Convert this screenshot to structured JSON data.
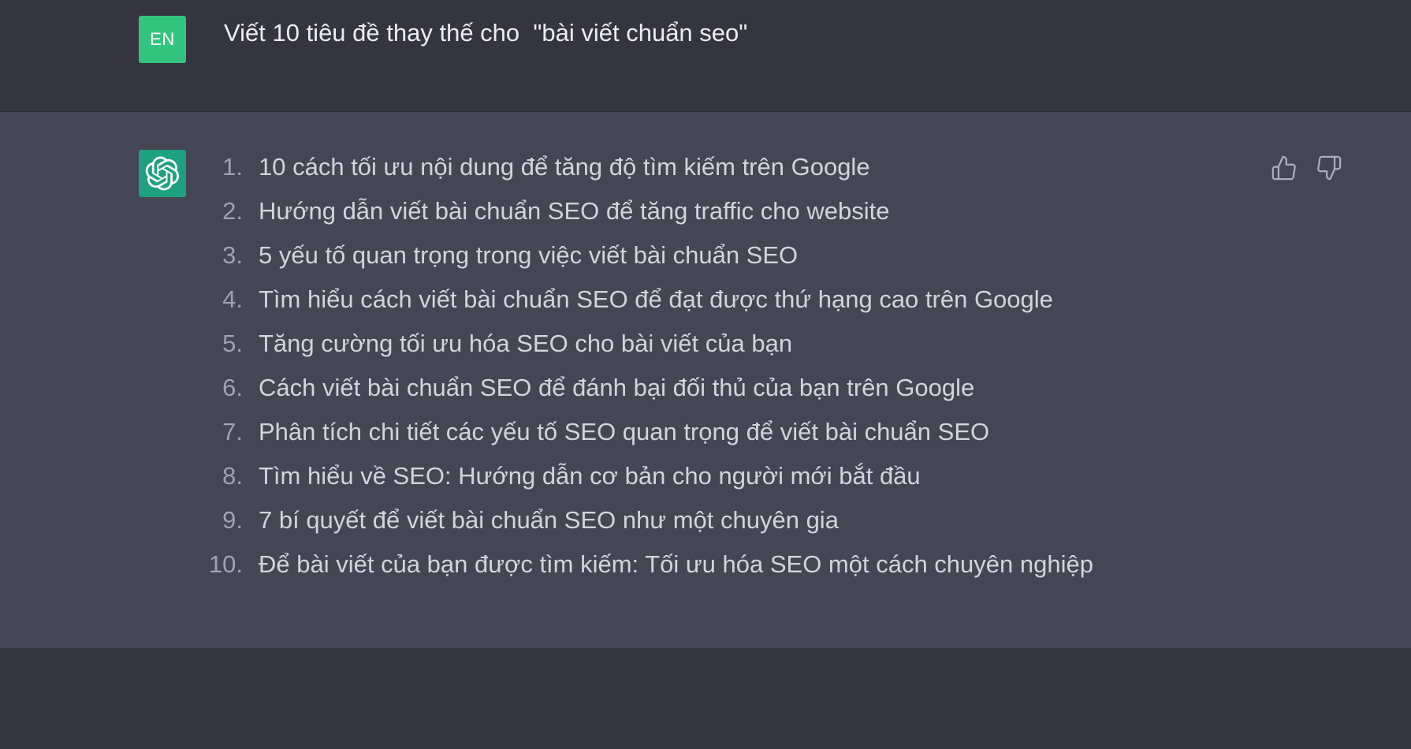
{
  "colors": {
    "user_avatar_bg": "#33c57d",
    "bot_avatar_bg": "#1ea180",
    "page_bg": "#343541",
    "answer_bg": "#444654"
  },
  "user_message": {
    "avatar_text": "EN",
    "text": "Viết 10 tiêu đề thay thế cho  \"bài viết chuẩn seo\""
  },
  "assistant_message": {
    "avatar_icon": "openai-logo-icon",
    "items": [
      {
        "num": "1.",
        "text": "10 cách tối ưu nội dung để tăng độ tìm kiếm trên Google"
      },
      {
        "num": "2.",
        "text": "Hướng dẫn viết bài chuẩn SEO để tăng traffic cho website"
      },
      {
        "num": "3.",
        "text": "5 yếu tố quan trọng trong việc viết bài chuẩn SEO"
      },
      {
        "num": "4.",
        "text": "Tìm hiểu cách viết bài chuẩn SEO để đạt được thứ hạng cao trên Google"
      },
      {
        "num": "5.",
        "text": "Tăng cường tối ưu hóa SEO cho bài viết của bạn"
      },
      {
        "num": "6.",
        "text": "Cách viết bài chuẩn SEO để đánh bại đối thủ của bạn trên Google"
      },
      {
        "num": "7.",
        "text": "Phân tích chi tiết các yếu tố SEO quan trọng để viết bài chuẩn SEO"
      },
      {
        "num": "8.",
        "text": "Tìm hiểu về SEO: Hướng dẫn cơ bản cho người mới bắt đầu"
      },
      {
        "num": "9.",
        "text": "7 bí quyết để viết bài chuẩn SEO như một chuyên gia"
      },
      {
        "num": "10.",
        "text": "Để bài viết của bạn được tìm kiếm: Tối ưu hóa SEO một cách chuyên nghiệp"
      }
    ],
    "feedback": {
      "up_icon": "thumbs-up-icon",
      "down_icon": "thumbs-down-icon"
    }
  }
}
